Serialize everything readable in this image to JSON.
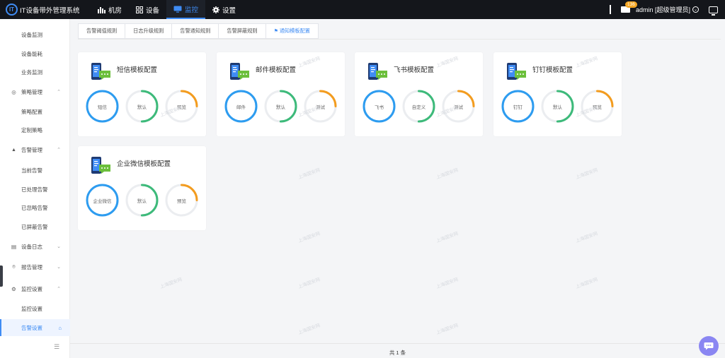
{
  "app": {
    "title": "IT设备带外管理系统",
    "logo_text": "IT"
  },
  "nav": [
    {
      "label": "机房",
      "icon": "bar-chart-icon"
    },
    {
      "label": "设备",
      "icon": "grid-icon"
    },
    {
      "label": "监控",
      "icon": "monitor-icon",
      "active": true
    },
    {
      "label": "设置",
      "icon": "gear-icon"
    }
  ],
  "header": {
    "mail_count": "136",
    "user": "admin [超级管理员]"
  },
  "sidebar": {
    "items": [
      {
        "label": "设备监测",
        "type": "sub"
      },
      {
        "label": "设备能耗",
        "type": "sub"
      },
      {
        "label": "业务监测",
        "type": "sub"
      },
      {
        "label": "策略管理",
        "type": "group",
        "icon": "shield-icon",
        "chevron": "up"
      },
      {
        "label": "策略配置",
        "type": "sub"
      },
      {
        "label": "定制策略",
        "type": "sub"
      },
      {
        "label": "告警管理",
        "type": "group",
        "icon": "bell-icon",
        "chevron": "up"
      },
      {
        "label": "当前告警",
        "type": "sub"
      },
      {
        "label": "已处理告警",
        "type": "sub"
      },
      {
        "label": "已忽略告警",
        "type": "sub"
      },
      {
        "label": "已屏蔽告警",
        "type": "sub"
      },
      {
        "label": "设备日志",
        "type": "group",
        "icon": "document-icon",
        "chevron": "down"
      },
      {
        "label": "报告管理",
        "type": "group",
        "icon": "location-icon",
        "chevron": "down"
      },
      {
        "label": "监控设置",
        "type": "group",
        "icon": "gear-icon",
        "chevron": "up"
      },
      {
        "label": "监控设置",
        "type": "sub"
      },
      {
        "label": "告警设置",
        "type": "sub",
        "active": true
      }
    ]
  },
  "tabs": [
    {
      "label": "告警阈值规则"
    },
    {
      "label": "日志升级规则"
    },
    {
      "label": "告警通知规则"
    },
    {
      "label": "告警屏蔽规则"
    },
    {
      "label": "通知模板配置",
      "active": true
    }
  ],
  "cards": [
    {
      "title": "短信模板配置",
      "rings": [
        {
          "label": "短信",
          "color": "#2d9cf0",
          "fraction": 1.0
        },
        {
          "label": "默认",
          "color": "#3dba7a",
          "fraction": 0.5
        },
        {
          "label": "预览",
          "color": "#f39c1f",
          "fraction": 0.25
        }
      ]
    },
    {
      "title": "邮件模板配置",
      "rings": [
        {
          "label": "邮件",
          "color": "#2d9cf0",
          "fraction": 1.0
        },
        {
          "label": "默认",
          "color": "#3dba7a",
          "fraction": 0.5
        },
        {
          "label": "测试",
          "color": "#f39c1f",
          "fraction": 0.25
        }
      ]
    },
    {
      "title": "飞书模板配置",
      "rings": [
        {
          "label": "飞书",
          "color": "#2d9cf0",
          "fraction": 1.0
        },
        {
          "label": "自定义",
          "color": "#3dba7a",
          "fraction": 0.5
        },
        {
          "label": "测试",
          "color": "#f39c1f",
          "fraction": 0.25
        }
      ]
    },
    {
      "title": "钉钉模板配置",
      "rings": [
        {
          "label": "钉钉",
          "color": "#2d9cf0",
          "fraction": 1.0
        },
        {
          "label": "默认",
          "color": "#3dba7a",
          "fraction": 0.5
        },
        {
          "label": "预览",
          "color": "#f39c1f",
          "fraction": 0.25
        }
      ]
    },
    {
      "title": "企业微信模板配置",
      "rings": [
        {
          "label": "企业微信",
          "color": "#2d9cf0",
          "fraction": 1.0
        },
        {
          "label": "默认",
          "color": "#3dba7a",
          "fraction": 0.5
        },
        {
          "label": "预览",
          "color": "#f39c1f",
          "fraction": 0.25
        }
      ]
    }
  ],
  "footer": {
    "total": "共 1 条"
  },
  "watermark": "上海国安网"
}
